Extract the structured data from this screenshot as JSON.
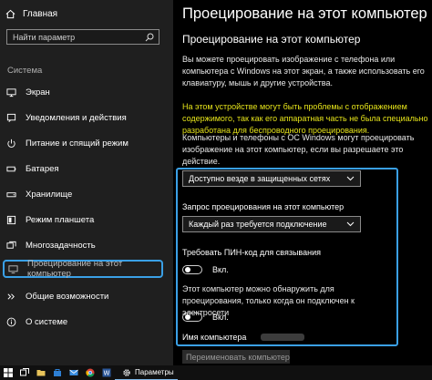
{
  "sidebar": {
    "home_label": "Главная",
    "search_placeholder": "Найти параметр",
    "section_title": "Система",
    "items": [
      {
        "label": "Экран",
        "icon": "monitor-icon"
      },
      {
        "label": "Уведомления и действия",
        "icon": "notifications-icon"
      },
      {
        "label": "Питание и спящий режим",
        "icon": "power-icon"
      },
      {
        "label": "Батарея",
        "icon": "battery-icon"
      },
      {
        "label": "Хранилище",
        "icon": "storage-icon"
      },
      {
        "label": "Режим планшета",
        "icon": "tablet-mode-icon"
      },
      {
        "label": "Многозадачность",
        "icon": "multitasking-icon"
      },
      {
        "label": "Проецирование на этот компьютер",
        "icon": "projecting-icon"
      },
      {
        "label": "Общие возможности",
        "icon": "shared-experiences-icon"
      },
      {
        "label": "О системе",
        "icon": "info-icon"
      }
    ],
    "active_index": 7
  },
  "main": {
    "title": "Проецирование на этот компьютер",
    "subtitle": "Проецирование на этот компьютер",
    "intro": "Вы можете проецировать изображение с телефона или компьютера с Windows на этот экран, а также использовать его клавиатуру, мышь и другие устройства.",
    "warning": "На этом устройстве могут быть проблемы с отображением содержимого, так как его аппаратная часть не была специально разработана для беспроводного проецирования.",
    "permission_text": "Компьютеры и телефоны с ОС Windows могут проецировать изображение на этот компьютер, если вы разрешаете это действие.",
    "availability_value": "Доступно везде в защищенных сетях",
    "request_label": "Запрос проецирования на этот компьютер",
    "request_value": "Каждый раз требуется подключение",
    "pin_label": "Требовать ПИН-код для связывания",
    "pin_toggle": "Вкл.",
    "power_text": "Этот компьютер можно обнаружить для проецирования, только когда он подключен к электросети",
    "power_toggle": "Вкл.",
    "pc_name_label": "Имя компьютера",
    "rename_button": "Переименовать компьютер"
  },
  "taskbar": {
    "settings_label": "Параметры"
  },
  "colors": {
    "accent": "#3aa0e6",
    "warning": "#e5e31a",
    "sidebar_bg": "#1f1f1f",
    "main_bg": "#000000"
  }
}
